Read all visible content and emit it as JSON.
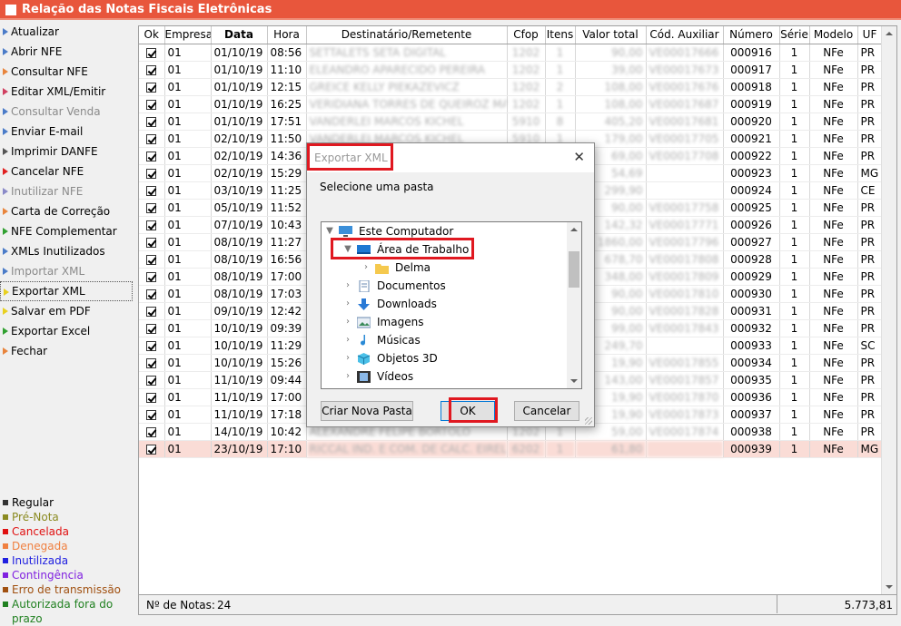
{
  "window": {
    "title": "Relação das Notas Fiscais Eletrônicas"
  },
  "sidebar": {
    "items": [
      {
        "label": "Atualizar",
        "disabled": false,
        "color": "#4a7bc8"
      },
      {
        "label": "Abrir NFE",
        "disabled": false,
        "color": "#4a7bc8"
      },
      {
        "label": "Consultar NFE",
        "disabled": false,
        "color": "#e8843c"
      },
      {
        "label": "Editar XML/Emitir",
        "disabled": false,
        "color": "#d04060"
      },
      {
        "label": "Consultar Venda",
        "disabled": true,
        "color": "#4a7bc8"
      },
      {
        "label": "Enviar E-mail",
        "disabled": false,
        "color": "#4a7bc8"
      },
      {
        "label": "Imprimir DANFE",
        "disabled": false,
        "color": "#555555"
      },
      {
        "label": "Cancelar NFE",
        "disabled": false,
        "color": "#e02020"
      },
      {
        "label": "Inutilizar NFE",
        "disabled": true,
        "color": "#8a8ac8"
      },
      {
        "label": "Carta de Correção",
        "disabled": false,
        "color": "#e8843c"
      },
      {
        "label": "NFE Complementar",
        "disabled": false,
        "color": "#30a030"
      },
      {
        "label": "XMLs Inutilizados",
        "disabled": false,
        "color": "#4a7bc8"
      },
      {
        "label": "Importar XML",
        "disabled": true,
        "color": "#4a7bc8"
      },
      {
        "label": "Exportar XML",
        "disabled": false,
        "color": "#e8d020",
        "selected": true
      },
      {
        "label": "Salvar em PDF",
        "disabled": false,
        "color": "#e8d020"
      },
      {
        "label": "Exportar Excel",
        "disabled": false,
        "color": "#30a030"
      },
      {
        "label": "Fechar",
        "disabled": false,
        "color": "#e8843c"
      }
    ]
  },
  "legend": [
    {
      "label": "Regular",
      "color": "#333333"
    },
    {
      "label": "Pré-Nota",
      "color": "#8a8a20"
    },
    {
      "label": "Cancelada",
      "color": "#e01010"
    },
    {
      "label": "Denegada",
      "color": "#f08040"
    },
    {
      "label": "Inutilizada",
      "color": "#2020e0"
    },
    {
      "label": "Contingência",
      "color": "#8020e0"
    },
    {
      "label": "Erro de transmissão",
      "color": "#a05010"
    },
    {
      "label": "Autorizada fora do prazo",
      "color": "#208020"
    }
  ],
  "table": {
    "headers": [
      "Ok",
      "Empresa",
      "Data",
      "Hora",
      "Destinatário/Remetente",
      "Cfop",
      "Itens",
      "Valor total",
      "Cód. Auxiliar",
      "Número",
      "Série",
      "Modelo",
      "UF"
    ],
    "rows": [
      {
        "empresa": "01",
        "data": "01/10/19",
        "hora": "08:56",
        "dest": "SETTALETS SETA DIGITAL",
        "cfop": "1202",
        "itens": "1",
        "valor": "90,00",
        "aux": "VE00017666",
        "numero": "000916",
        "serie": "1",
        "modelo": "NFe",
        "uf": "PR",
        "cancel": false
      },
      {
        "empresa": "01",
        "data": "01/10/19",
        "hora": "11:10",
        "dest": "ELEANDRO APARECIDO PEREIRA",
        "cfop": "1202",
        "itens": "1",
        "valor": "39,00",
        "aux": "VE00017673",
        "numero": "000917",
        "serie": "1",
        "modelo": "NFe",
        "uf": "PR",
        "cancel": false
      },
      {
        "empresa": "01",
        "data": "01/10/19",
        "hora": "12:15",
        "dest": "GREICE KELLY PIEKAZEVICZ",
        "cfop": "1202",
        "itens": "2",
        "valor": "108,00",
        "aux": "VE00017676",
        "numero": "000918",
        "serie": "1",
        "modelo": "NFe",
        "uf": "PR",
        "cancel": false
      },
      {
        "empresa": "01",
        "data": "01/10/19",
        "hora": "16:25",
        "dest": "VERIDIANA TORRES DE QUEIROZ MARDE",
        "cfop": "1202",
        "itens": "1",
        "valor": "108,00",
        "aux": "VE00017687",
        "numero": "000919",
        "serie": "1",
        "modelo": "NFe",
        "uf": "PR",
        "cancel": false
      },
      {
        "empresa": "01",
        "data": "01/10/19",
        "hora": "17:51",
        "dest": "VANDERLEI MARCOS KICHEL",
        "cfop": "5910",
        "itens": "8",
        "valor": "405,20",
        "aux": "VE00017681",
        "numero": "000920",
        "serie": "1",
        "modelo": "NFe",
        "uf": "PR",
        "cancel": false
      },
      {
        "empresa": "01",
        "data": "02/10/19",
        "hora": "11:50",
        "dest": "VANDERLEI MARCOS KICHEL",
        "cfop": "5910",
        "itens": "1",
        "valor": "179,00",
        "aux": "VE00017705",
        "numero": "000921",
        "serie": "1",
        "modelo": "NFe",
        "uf": "PR",
        "cancel": false
      },
      {
        "empresa": "01",
        "data": "02/10/19",
        "hora": "14:36",
        "dest": "",
        "cfop": "",
        "itens": "",
        "valor": "69,00",
        "aux": "VE00017708",
        "numero": "000922",
        "serie": "1",
        "modelo": "NFe",
        "uf": "PR",
        "cancel": false
      },
      {
        "empresa": "01",
        "data": "02/10/19",
        "hora": "15:29",
        "dest": "",
        "cfop": "",
        "itens": "",
        "valor": "54,69",
        "aux": "",
        "numero": "000923",
        "serie": "1",
        "modelo": "NFe",
        "uf": "MG",
        "cancel": false
      },
      {
        "empresa": "01",
        "data": "03/10/19",
        "hora": "11:25",
        "dest": "",
        "cfop": "",
        "itens": "",
        "valor": "299,90",
        "aux": "",
        "numero": "000924",
        "serie": "1",
        "modelo": "NFe",
        "uf": "CE",
        "cancel": false
      },
      {
        "empresa": "01",
        "data": "05/10/19",
        "hora": "11:52",
        "dest": "",
        "cfop": "",
        "itens": "",
        "valor": "90,00",
        "aux": "VE00017758",
        "numero": "000925",
        "serie": "1",
        "modelo": "NFe",
        "uf": "PR",
        "cancel": false
      },
      {
        "empresa": "01",
        "data": "07/10/19",
        "hora": "10:43",
        "dest": "",
        "cfop": "",
        "itens": "",
        "valor": "142,32",
        "aux": "VE00017771",
        "numero": "000926",
        "serie": "1",
        "modelo": "NFe",
        "uf": "PR",
        "cancel": false
      },
      {
        "empresa": "01",
        "data": "08/10/19",
        "hora": "11:27",
        "dest": "",
        "cfop": "",
        "itens": "",
        "valor": "1860,00",
        "aux": "VE00017796",
        "numero": "000927",
        "serie": "1",
        "modelo": "NFe",
        "uf": "PR",
        "cancel": false
      },
      {
        "empresa": "01",
        "data": "08/10/19",
        "hora": "16:56",
        "dest": "",
        "cfop": "",
        "itens": "",
        "valor": "678,70",
        "aux": "VE00017808",
        "numero": "000928",
        "serie": "1",
        "modelo": "NFe",
        "uf": "PR",
        "cancel": false
      },
      {
        "empresa": "01",
        "data": "08/10/19",
        "hora": "17:00",
        "dest": "",
        "cfop": "",
        "itens": "",
        "valor": "348,00",
        "aux": "VE00017809",
        "numero": "000929",
        "serie": "1",
        "modelo": "NFe",
        "uf": "PR",
        "cancel": false
      },
      {
        "empresa": "01",
        "data": "08/10/19",
        "hora": "17:03",
        "dest": "",
        "cfop": "",
        "itens": "",
        "valor": "90,00",
        "aux": "VE00017810",
        "numero": "000930",
        "serie": "1",
        "modelo": "NFe",
        "uf": "PR",
        "cancel": false
      },
      {
        "empresa": "01",
        "data": "09/10/19",
        "hora": "12:42",
        "dest": "",
        "cfop": "",
        "itens": "",
        "valor": "90,00",
        "aux": "VE00017828",
        "numero": "000931",
        "serie": "1",
        "modelo": "NFe",
        "uf": "PR",
        "cancel": false
      },
      {
        "empresa": "01",
        "data": "10/10/19",
        "hora": "09:39",
        "dest": "",
        "cfop": "",
        "itens": "",
        "valor": "99,00",
        "aux": "VE00017843",
        "numero": "000932",
        "serie": "1",
        "modelo": "NFe",
        "uf": "PR",
        "cancel": false
      },
      {
        "empresa": "01",
        "data": "10/10/19",
        "hora": "11:29",
        "dest": "",
        "cfop": "",
        "itens": "",
        "valor": "249,70",
        "aux": "",
        "numero": "000933",
        "serie": "1",
        "modelo": "NFe",
        "uf": "SC",
        "cancel": false
      },
      {
        "empresa": "01",
        "data": "10/10/19",
        "hora": "15:26",
        "dest": "",
        "cfop": "",
        "itens": "",
        "valor": "19,90",
        "aux": "VE00017855",
        "numero": "000934",
        "serie": "1",
        "modelo": "NFe",
        "uf": "PR",
        "cancel": false
      },
      {
        "empresa": "01",
        "data": "11/10/19",
        "hora": "09:44",
        "dest": "",
        "cfop": "",
        "itens": "",
        "valor": "143,00",
        "aux": "VE00017857",
        "numero": "000935",
        "serie": "1",
        "modelo": "NFe",
        "uf": "PR",
        "cancel": false
      },
      {
        "empresa": "01",
        "data": "11/10/19",
        "hora": "17:00",
        "dest": "",
        "cfop": "",
        "itens": "",
        "valor": "19,90",
        "aux": "VE00017870",
        "numero": "000936",
        "serie": "1",
        "modelo": "NFe",
        "uf": "PR",
        "cancel": false
      },
      {
        "empresa": "01",
        "data": "11/10/19",
        "hora": "17:18",
        "dest": "",
        "cfop": "",
        "itens": "",
        "valor": "19,90",
        "aux": "VE00017873",
        "numero": "000937",
        "serie": "1",
        "modelo": "NFe",
        "uf": "PR",
        "cancel": false
      },
      {
        "empresa": "01",
        "data": "14/10/19",
        "hora": "10:42",
        "dest": "ALEXANDRE FELIPE BORTOLO",
        "cfop": "1202",
        "itens": "1",
        "valor": "59,00",
        "aux": "VE00017874",
        "numero": "000938",
        "serie": "1",
        "modelo": "NFe",
        "uf": "PR",
        "cancel": false
      },
      {
        "empresa": "01",
        "data": "23/10/19",
        "hora": "17:10",
        "dest": "RICCAL IND. E COM. DE CALC. EIRELI",
        "cfop": "6202",
        "itens": "1",
        "valor": "61,80",
        "aux": "",
        "numero": "000939",
        "serie": "1",
        "modelo": "NFe",
        "uf": "MG",
        "cancel": true
      }
    ]
  },
  "footer": {
    "count_label": "Nº de Notas:",
    "count": "24",
    "total": "5.773,81"
  },
  "dialog": {
    "title": "Exportar XML",
    "prompt": "Selecione uma pasta",
    "tree": [
      {
        "label": "Este Computador",
        "icon": "computer-icon",
        "expanded": true,
        "level": 0
      },
      {
        "label": "Área de Trabalho",
        "icon": "desktop-icon",
        "expanded": true,
        "level": 1,
        "selected": true
      },
      {
        "label": "Delma",
        "icon": "folder-icon",
        "expanded": false,
        "level": 2
      },
      {
        "label": "Documentos",
        "icon": "documents-icon",
        "expanded": false,
        "level": 1
      },
      {
        "label": "Downloads",
        "icon": "downloads-icon",
        "expanded": false,
        "level": 1
      },
      {
        "label": "Imagens",
        "icon": "pictures-icon",
        "expanded": false,
        "level": 1
      },
      {
        "label": "Músicas",
        "icon": "music-icon",
        "expanded": false,
        "level": 1
      },
      {
        "label": "Objetos 3D",
        "icon": "objects-3d-icon",
        "expanded": false,
        "level": 1
      },
      {
        "label": "Vídeos",
        "icon": "videos-icon",
        "expanded": false,
        "level": 1
      }
    ],
    "buttons": {
      "new_folder": "Criar Nova Pasta",
      "ok": "OK",
      "cancel": "Cancelar"
    }
  },
  "colors": {
    "title_bar": "#e8563c",
    "highlight": "#e01820",
    "cancel_row": "#fadcd6"
  }
}
